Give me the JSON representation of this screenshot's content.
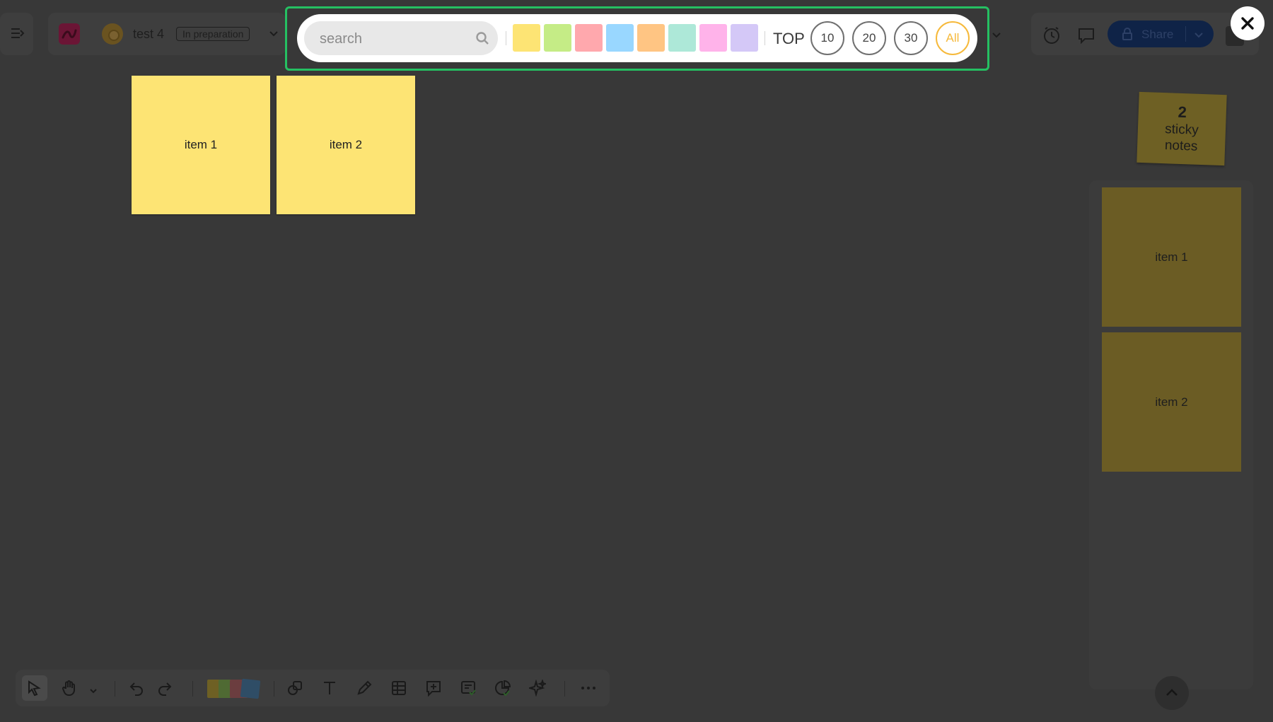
{
  "header": {
    "board_title": "test 4",
    "status_badge": "In preparation",
    "share_label": "Share"
  },
  "filter_bar": {
    "search_placeholder": "search",
    "color_swatches": [
      "#fde474",
      "#c5ec86",
      "#ffa8ad",
      "#99d7ff",
      "#ffc583",
      "#ade8d8",
      "#ffb3ea",
      "#d4c8f7"
    ],
    "top_label": "TOP",
    "count_options": [
      "10",
      "20",
      "30",
      "All"
    ],
    "active_option": "All"
  },
  "canvas": {
    "sticky_notes": [
      {
        "label": "item 1",
        "color": "#fde474"
      },
      {
        "label": "item 2",
        "color": "#fde474"
      }
    ]
  },
  "side_panel": {
    "count": "2",
    "count_label": "sticky notes",
    "items": [
      "item 1",
      "item 2"
    ]
  },
  "colors": {
    "accent_frame": "#25c062",
    "active_count": "#f6b93b",
    "canvas_background": "#383838"
  }
}
